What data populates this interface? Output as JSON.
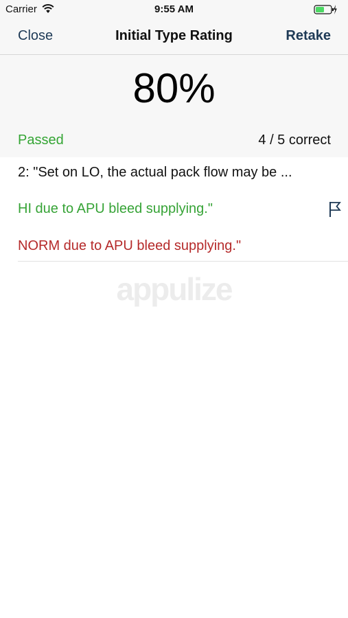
{
  "status_bar": {
    "carrier": "Carrier",
    "time": "9:55 AM",
    "wifi_icon": "wifi-icon",
    "battery_icon": "battery-charging-icon",
    "battery_color": "#4cd964"
  },
  "nav": {
    "close_label": "Close",
    "title": "Initial Type Rating",
    "retake_label": "Retake",
    "accent_color": "#1e3a56"
  },
  "score": {
    "percent": "80%",
    "status": "Passed",
    "status_color": "#34a534",
    "count": "4 / 5 correct"
  },
  "question": {
    "text": "2: \"Set on LO, the actual pack flow may be ...",
    "correct_answer": "HI due to APU bleed supplying.\"",
    "correct_color": "#36a336",
    "wrong_answer": "NORM due to APU bleed supplying.\"",
    "wrong_color": "#b52a2a",
    "flag_icon": "flag-icon"
  },
  "watermark": "appulize"
}
